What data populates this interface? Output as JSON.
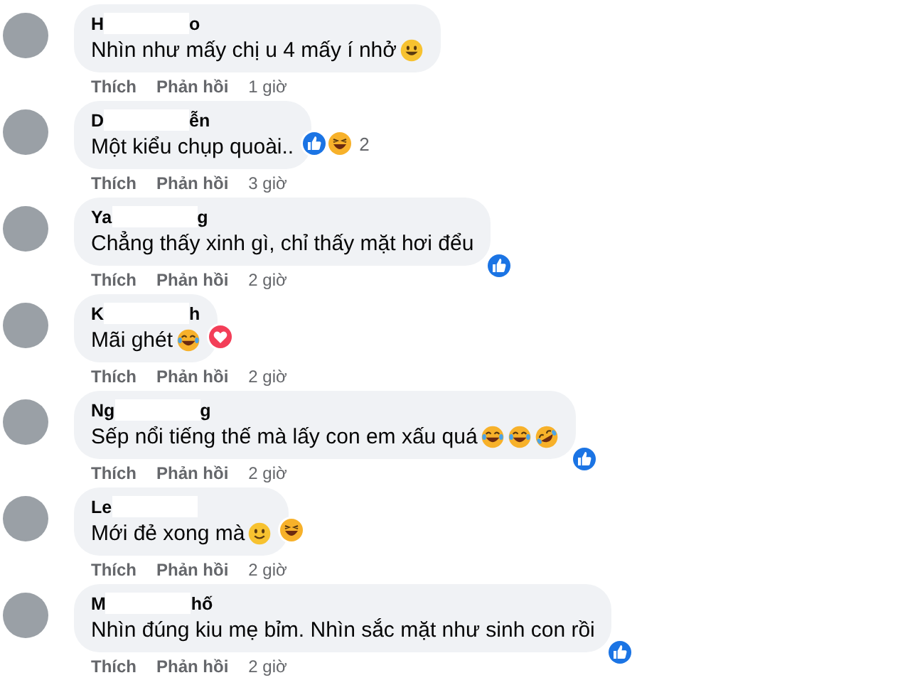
{
  "comments": [
    {
      "name_parts": [
        "H",
        "o"
      ],
      "text": "Nhìn như mấy chị u 4 mấy í nhở",
      "emojis": [
        {
          "kind": "grin"
        }
      ],
      "actions": {
        "like": "Thích",
        "reply": "Phản hồi",
        "time": "1 giờ"
      }
    },
    {
      "name_parts": [
        "D",
        "ễn"
      ],
      "text": "Một kiểu chụp quoài..",
      "reactions": [
        {
          "kind": "like"
        },
        {
          "kind": "haha"
        }
      ],
      "reaction_count": "2",
      "actions": {
        "like": "Thích",
        "reply": "Phản hồi",
        "time": "3 giờ"
      }
    },
    {
      "name_parts": [
        "Ya",
        "g"
      ],
      "text": "Chẳng thấy xinh gì, chỉ thấy mặt hơi đểu",
      "reactions": [
        {
          "kind": "like"
        }
      ],
      "actions": {
        "like": "Thích",
        "reply": "Phản hồi",
        "time": "2 giờ"
      }
    },
    {
      "name_parts": [
        "K",
        "h"
      ],
      "text": "Mãi ghét",
      "emojis": [
        {
          "kind": "laugh-tears"
        }
      ],
      "reactions": [
        {
          "kind": "love"
        }
      ],
      "actions": {
        "like": "Thích",
        "reply": "Phản hồi",
        "time": "2 giờ"
      }
    },
    {
      "name_parts": [
        "Ng",
        "g"
      ],
      "text": "Sếp nổi tiếng thế mà lấy con em xấu quá",
      "emojis": [
        {
          "kind": "laugh-tears"
        },
        {
          "kind": "laugh-tears"
        },
        {
          "kind": "rofl"
        }
      ],
      "reactions": [
        {
          "kind": "like"
        }
      ],
      "actions": {
        "like": "Thích",
        "reply": "Phản hồi",
        "time": "2 giờ"
      }
    },
    {
      "name_parts": [
        "Le"
      ],
      "text": "Mới đẻ xong mà",
      "emojis": [
        {
          "kind": "smile"
        }
      ],
      "reactions": [
        {
          "kind": "haha"
        }
      ],
      "actions": {
        "like": "Thích",
        "reply": "Phản hồi",
        "time": "2 giờ"
      }
    },
    {
      "name_parts": [
        "M",
        "hố"
      ],
      "text": "Nhìn đúng kiu mẹ bỉm. Nhìn sắc mặt như sinh con rồi",
      "reactions": [
        {
          "kind": "like"
        }
      ],
      "actions": {
        "like": "Thích",
        "reply": "Phản hồi",
        "time": "2 giờ"
      }
    }
  ]
}
